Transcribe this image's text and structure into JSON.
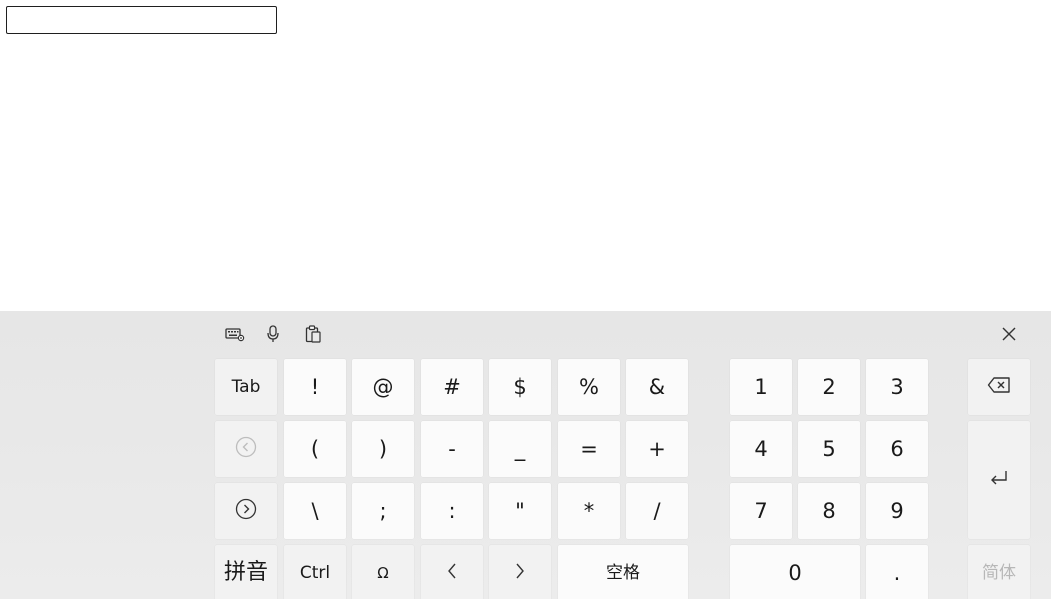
{
  "text_box": {
    "value": ""
  },
  "keyboard": {
    "toolbar": {
      "settings_icon": "keyboard-settings-icon",
      "mic_icon": "microphone-icon",
      "clipboard_icon": "clipboard-icon",
      "close_icon": "close-icon"
    },
    "keys": {
      "tab": "Tab",
      "excl": "!",
      "at": "@",
      "hash": "#",
      "dollar": "$",
      "percent": "%",
      "amp": "&",
      "lparen": "(",
      "rparen": ")",
      "minus": "-",
      "underscore": "_",
      "equals": "=",
      "plus": "+",
      "backslash": "\\",
      "semicolon": ";",
      "colon": ":",
      "quote": "\"",
      "star": "*",
      "slash": "/",
      "pinyin": "拼音",
      "ctrl": "Ctrl",
      "omega": "Ω",
      "lt": "<",
      "gt": ">",
      "space": "空格",
      "n1": "1",
      "n2": "2",
      "n3": "3",
      "n4": "4",
      "n5": "5",
      "n6": "6",
      "n7": "7",
      "n8": "8",
      "n9": "9",
      "n0": "0",
      "dot": ".",
      "simplified": "简体"
    }
  }
}
